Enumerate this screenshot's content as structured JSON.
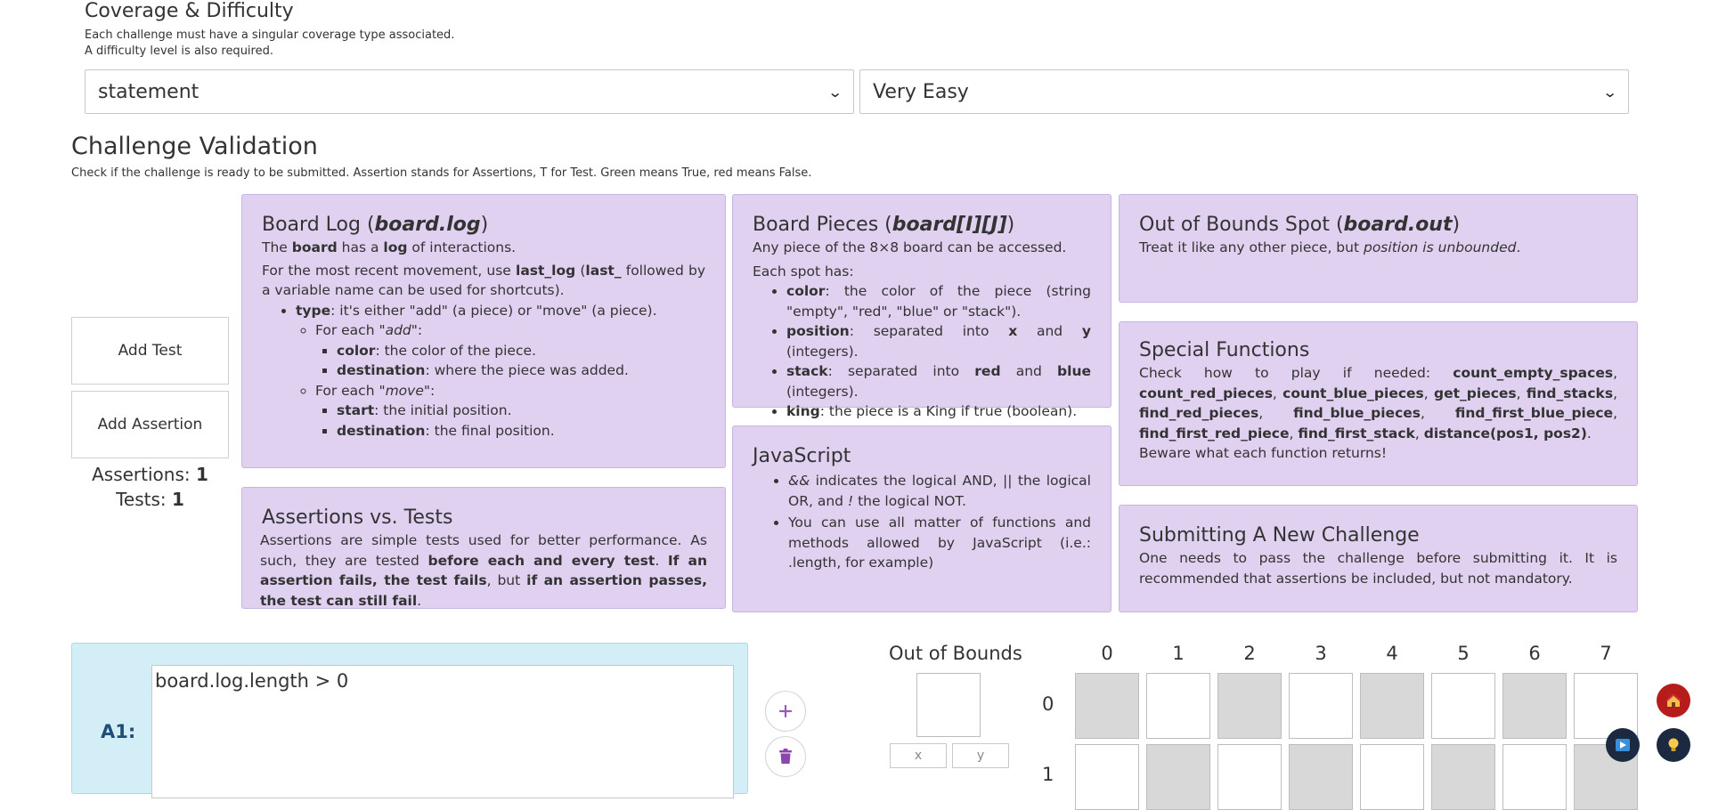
{
  "coverage": {
    "title": "Coverage & Difficulty",
    "desc1": "Each challenge must have a singular coverage type associated.",
    "desc2": "A difficulty level is also required.",
    "coverage_value": "statement",
    "difficulty_value": "Very Easy"
  },
  "validation": {
    "title": "Challenge Validation",
    "desc": "Check if the challenge is ready to be submitted. Assertion stands for Assertions, T for Test. Green means True, red means False."
  },
  "sidebar": {
    "add_test": "Add Test",
    "add_assertion": "Add Assertion",
    "assertions_label": "Assertions:",
    "assertions_count": "1",
    "tests_label": "Tests:",
    "tests_count": "1"
  },
  "panels": {
    "board_log": {
      "title_prefix": "Board Log (",
      "title_code": "board.log",
      "title_suffix": ")",
      "line1_a": "The ",
      "line1_b": "board",
      "line1_c": " has a ",
      "line1_d": "log",
      "line1_e": " of interactions.",
      "line2_a": "For the most recent movement, use ",
      "line2_b": "last_log",
      "line2_c": " (",
      "line2_d": "last_",
      "line2_e": " followed by a variable name can be used for shortcuts).",
      "type_b": "type",
      "type_t": ": it's either \"add\" (a piece) or \"move\" (a piece).",
      "add_a": "For each ",
      "add_i": "\"add\"",
      "add_c": ":",
      "add_color_b": "color",
      "add_color_t": ": the color of the piece.",
      "add_dest_b": "destination",
      "add_dest_t": ": where the piece was added.",
      "move_a": "For each ",
      "move_i": "\"move\"",
      "move_c": ":",
      "move_start_b": "start",
      "move_start_t": ": the initial position.",
      "move_dest_b": "destination",
      "move_dest_t": ": the final position."
    },
    "board_pieces": {
      "title_prefix": "Board Pieces (",
      "title_code": "board[I][J]",
      "title_suffix": ")",
      "line1": "Any piece of the 8×8 board can be accessed.",
      "line2": "Each spot has:",
      "color_b": "color",
      "color_t": ": the color of the piece (string \"empty\", \"red\", \"blue\" or \"stack\").",
      "pos_b": "position",
      "pos_t1": ": separated into ",
      "pos_x": "x",
      "pos_t2": " and ",
      "pos_y": "y",
      "pos_t3": " (integers).",
      "stack_b": "stack",
      "stack_t1": ": separated into ",
      "stack_red": "red",
      "stack_t2": " and ",
      "stack_blue": "blue",
      "stack_t3": " (integers).",
      "king_b": "king",
      "king_t": ": the piece is a King if true (boolean)."
    },
    "out_of_bounds": {
      "title_prefix": "Out of Bounds Spot (",
      "title_code": "board.out",
      "title_suffix": ")",
      "text_a": "Treat it like any other piece, but ",
      "text_i": "position is unbounded",
      "text_c": "."
    },
    "special": {
      "title": "Special Functions",
      "lead": "Check how to play if needed: ",
      "f1": "count_empty_spaces",
      "f2": "count_red_pieces",
      "f3": "count_blue_pieces",
      "f4": "get_pieces",
      "f5": "find_stacks",
      "f6": "find_red_pieces",
      "f7": "find_blue_pieces",
      "f8": "find_first_blue_piece",
      "f9": "find_first_red_piece",
      "f10": "find_first_stack",
      "f11": "distance(pos1, pos2)",
      "sep": ", ",
      "end": ".",
      "beware": "Beware what each function returns!"
    },
    "assertions_tests": {
      "title": "Assertions vs. Tests",
      "t1": "Assertions are simple tests used for better performance. As such, they are tested ",
      "t2": "before each and every test",
      "t3": ". ",
      "t4": "If an assertion fails, the test fails",
      "t5": ", but ",
      "t6": "if an assertion passes, the test can still fail",
      "t7": "."
    },
    "javascript": {
      "title": "JavaScript",
      "li1_a": "&&",
      "li1_b": " indicates the logical AND, ",
      "li1_c": "||",
      "li1_d": " the logical OR, and ",
      "li1_e": "!",
      "li1_f": " the logical NOT.",
      "li2": "You can use all matter of functions and methods allowed by JavaScript (i.e.: .length, for example)"
    },
    "submitting": {
      "title": "Submitting A New Challenge",
      "text": "One needs to pass the challenge before submitting it. It is recommended that assertions be included, but not mandatory."
    }
  },
  "assertion_editor": {
    "label": "A1:",
    "code": "board.log.length > 0"
  },
  "board": {
    "oob_title": "Out of Bounds",
    "x_placeholder": "x",
    "y_placeholder": "y",
    "columns": [
      "0",
      "1",
      "2",
      "3",
      "4",
      "5",
      "6",
      "7"
    ],
    "rows": [
      "0",
      "1"
    ]
  },
  "colors": {
    "panel_purple": "#e0d1f1",
    "panel_blue": "#d3eef7",
    "cell_gray": "#d8d8d8",
    "accent_purple": "#9b59b6",
    "delete_purple": "#8e44ad",
    "float_red": "#b71c1c",
    "float_navy": "#1b2a41"
  },
  "icons": {
    "add": "plus-icon",
    "delete": "trash-icon",
    "home": "home-icon",
    "hint": "lightbulb-icon",
    "send": "send-icon"
  }
}
